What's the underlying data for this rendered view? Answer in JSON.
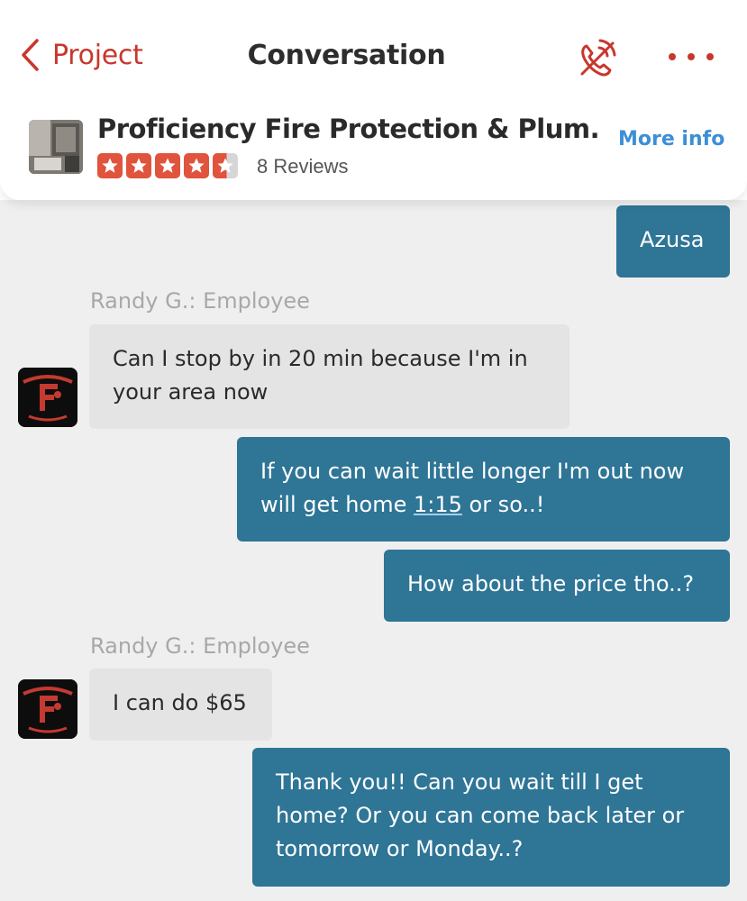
{
  "nav": {
    "back_label": "Project",
    "title": "Conversation",
    "call_icon": "phone-call-icon",
    "more_icon": "more-dots-icon",
    "accent_color": "#c8372d"
  },
  "business": {
    "name": "Proficiency Fire Protection & Plum...",
    "rating": 4.5,
    "rating_max": 5,
    "reviews_label": "8 Reviews",
    "more_info_label": "More info",
    "star_color": "#e0533d",
    "link_color": "#3d8fd6"
  },
  "messages": [
    {
      "direction": "outgoing",
      "text": "Azusa"
    },
    {
      "direction": "incoming",
      "sender": "Randy G.: Employee",
      "lines": [
        "Can I stop by in 20 min because I'm in",
        "your area now"
      ]
    },
    {
      "direction": "outgoing",
      "line1": "If you can wait little longer I'm out now",
      "line2_pre": "will get home ",
      "line2_link": "1:15",
      "line2_post": " or so..!"
    },
    {
      "direction": "outgoing",
      "text": "How about the price tho..?"
    },
    {
      "direction": "incoming",
      "sender": "Randy G.: Employee",
      "text": "I can do $65"
    },
    {
      "direction": "outgoing",
      "lines": [
        "Thank you!! Can you wait till I get",
        "home? Or you can come back later or",
        "tomorrow or Monday..?"
      ]
    }
  ],
  "colors": {
    "outgoing_bubble": "#2e7596",
    "incoming_bubble": "#e4e4e4",
    "thread_background": "#efefef"
  }
}
